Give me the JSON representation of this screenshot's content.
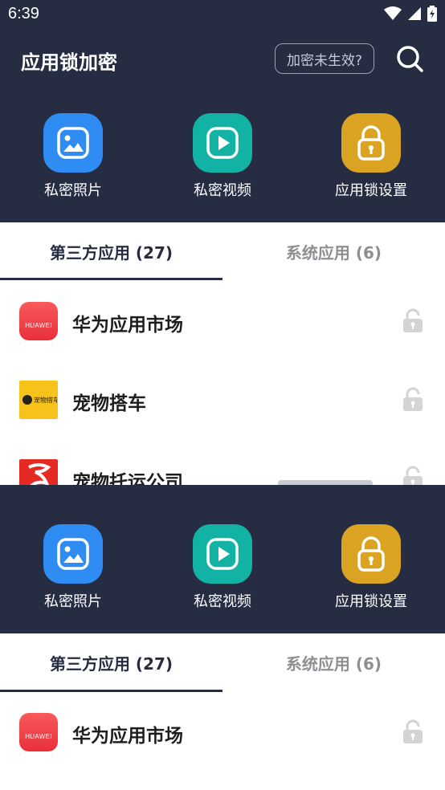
{
  "status_bar": {
    "time": "6:39"
  },
  "header": {
    "title": "应用锁加密",
    "encrypt_hint": "加密未生效?"
  },
  "features": [
    {
      "label": "私密照片",
      "icon": "photo-icon",
      "color": "#2f8cf2"
    },
    {
      "label": "私密视频",
      "icon": "video-play-icon",
      "color": "#12b3a4"
    },
    {
      "label": "应用锁设置",
      "icon": "padlock-icon",
      "color": "#dba322"
    }
  ],
  "tabs": [
    {
      "label": "第三方应用 (27)",
      "active": true
    },
    {
      "label": "系统应用 (6)",
      "active": false
    }
  ],
  "apps": [
    {
      "name": "华为应用市场",
      "icon_text": "HUAWEI",
      "locked": false
    },
    {
      "name": "宠物搭车",
      "icon_text": "宠物搭车",
      "locked": false
    },
    {
      "name": "宠物托运公司",
      "locked": false
    }
  ],
  "lower": {
    "features": [
      {
        "label": "私密照片"
      },
      {
        "label": "私密视频"
      },
      {
        "label": "应用锁设置"
      }
    ],
    "tabs": [
      {
        "label": "第三方应用 (27)"
      },
      {
        "label": "系统应用 (6)"
      }
    ],
    "apps": [
      {
        "name": "华为应用市场",
        "icon_text": "HUAWEI"
      }
    ]
  }
}
